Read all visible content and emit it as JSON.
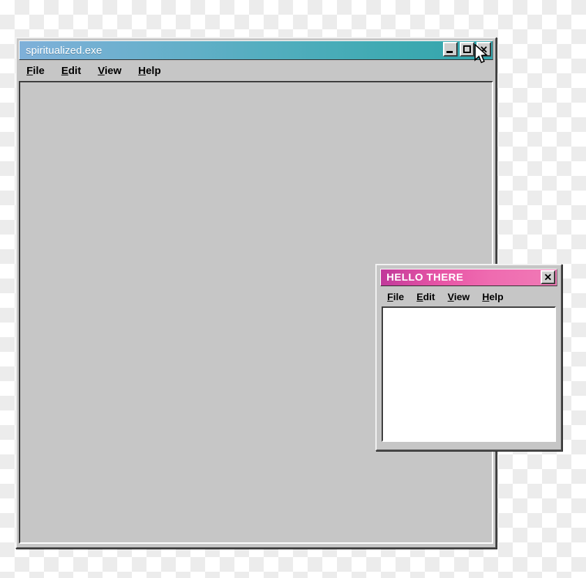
{
  "main_window": {
    "title": "spiritualized.exe",
    "titlebar_gradient_from": "#7fb0d9",
    "titlebar_gradient_to": "#32a4ab",
    "menu": [
      {
        "label": "File",
        "accel": "F",
        "rest": "ile"
      },
      {
        "label": "Edit",
        "accel": "E",
        "rest": "dit"
      },
      {
        "label": "View",
        "accel": "V",
        "rest": "iew"
      },
      {
        "label": "Help",
        "accel": "H",
        "rest": "elp"
      }
    ],
    "controls": {
      "minimize": "minimize",
      "maximize": "maximize",
      "close": "close"
    },
    "content": ""
  },
  "dialog_window": {
    "title": "HELLO THERE",
    "titlebar_gradient_from": "#c0389a",
    "titlebar_gradient_to": "#f07ab6",
    "menu": [
      {
        "label": "File",
        "accel": "F",
        "rest": "ile"
      },
      {
        "label": "Edit",
        "accel": "E",
        "rest": "dit"
      },
      {
        "label": "View",
        "accel": "V",
        "rest": "iew"
      },
      {
        "label": "Help",
        "accel": "H",
        "rest": "elp"
      }
    ],
    "controls": {
      "close": "✕"
    },
    "content": ""
  },
  "cursor": {
    "kind": "arrow-pointer",
    "over": "close"
  },
  "theme": {
    "window_face": "#c6c6c6",
    "window_highlight": "#ffffff",
    "window_shadow": "#3c3c3c",
    "text": "#000000",
    "title_text": "#ffffff",
    "client_white": "#ffffff"
  }
}
